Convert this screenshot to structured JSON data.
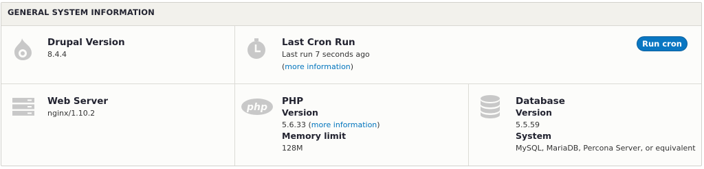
{
  "panel": {
    "title": "GENERAL SYSTEM INFORMATION"
  },
  "drupal": {
    "icon": "drupal-drop-icon",
    "title": "Drupal Version",
    "version": "8.4.4"
  },
  "cron": {
    "icon": "clock-icon",
    "title": "Last Cron Run",
    "last_run": "Last run 7 seconds ago",
    "paren_open": "(",
    "link": "more information",
    "paren_close": ")",
    "button": "Run cron"
  },
  "webserver": {
    "icon": "server-icon",
    "title": "Web Server",
    "value": "nginx/1.10.2"
  },
  "php": {
    "icon": "php-icon",
    "icon_text": "php",
    "title": "PHP",
    "version_label": "Version",
    "version_value": "5.6.33",
    "paren_open": "(",
    "link": "more information",
    "paren_close": ")",
    "memory_label": "Memory limit",
    "memory_value": "128M"
  },
  "database": {
    "icon": "database-icon",
    "title": "Database",
    "version_label": "Version",
    "version_value": "5.5.59",
    "system_label": "System",
    "system_value": "MySQL, MariaDB, Percona Server, or equivalent"
  },
  "colors": {
    "accent": "#0074bd",
    "button": "#0a77c2",
    "icon_gray": "#c8c8c8"
  }
}
